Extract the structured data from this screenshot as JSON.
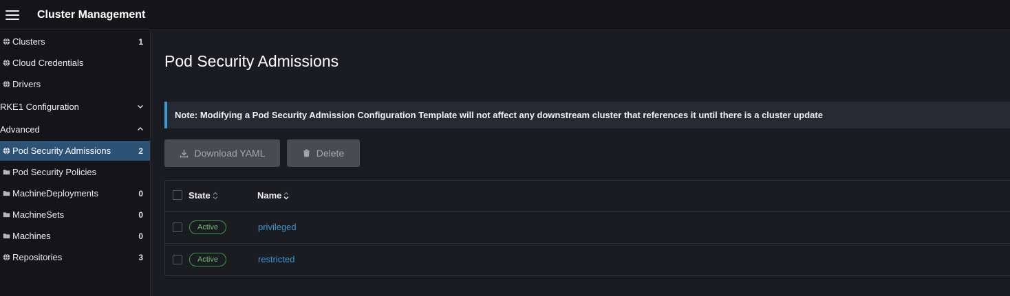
{
  "header": {
    "menu_icon": "hamburger-menu-icon",
    "title": "Cluster Management"
  },
  "sidebar": {
    "items": [
      {
        "label": "Clusters",
        "count": "1",
        "icon": "globe-icon"
      },
      {
        "label": "Cloud Credentials",
        "count": "",
        "icon": "globe-icon"
      },
      {
        "label": "Drivers",
        "count": "",
        "icon": "globe-icon"
      }
    ],
    "groups": [
      {
        "label": "RKE1 Configuration",
        "expanded": false
      },
      {
        "label": "Advanced",
        "expanded": true
      }
    ],
    "advanced_items": [
      {
        "label": "Pod Security Admissions",
        "count": "2",
        "icon": "globe-icon",
        "active": true
      },
      {
        "label": "Pod Security Policies",
        "count": "",
        "icon": "folder-icon"
      },
      {
        "label": "MachineDeployments",
        "count": "0",
        "icon": "folder-icon"
      },
      {
        "label": "MachineSets",
        "count": "0",
        "icon": "folder-icon"
      },
      {
        "label": "Machines",
        "count": "0",
        "icon": "folder-icon"
      },
      {
        "label": "Repositories",
        "count": "3",
        "icon": "globe-icon"
      }
    ]
  },
  "main": {
    "title": "Pod Security Admissions",
    "banner": "Note: Modifying a Pod Security Admission Configuration Template will not affect any downstream cluster that references it until there is a cluster update",
    "buttons": {
      "download": "Download YAML",
      "delete": "Delete"
    },
    "table": {
      "columns": [
        "State",
        "Name"
      ],
      "rows": [
        {
          "state": "Active",
          "name": "privileged"
        },
        {
          "state": "Active",
          "name": "restricted"
        }
      ]
    }
  },
  "colors": {
    "accent": "#3d98d3",
    "active_nav": "#2c5376",
    "status_active": "#3e9b4a",
    "background": "#1b1c21",
    "sidebar": "#141419"
  }
}
